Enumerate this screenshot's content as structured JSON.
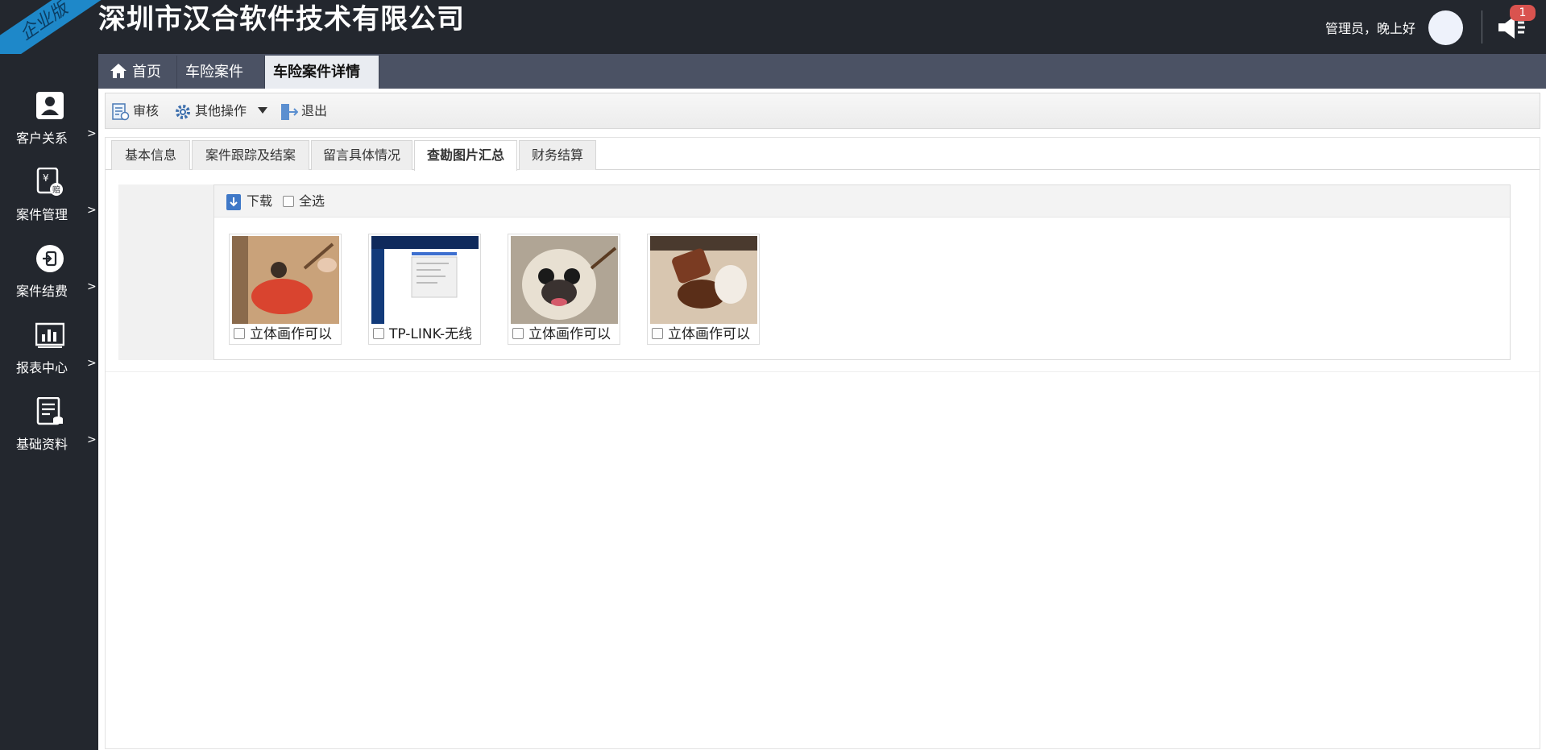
{
  "header": {
    "edition_ribbon": "企业版",
    "company_name": "深圳市汉合软件技术有限公司",
    "greeting": "管理员，晚上好",
    "notification_count": "1",
    "colors": {
      "bg": "#23272e",
      "badge": "#d9534f"
    }
  },
  "sidebar": {
    "items": [
      {
        "label": "客户关系",
        "icon": "contact-card-icon",
        "arrow": ">"
      },
      {
        "label": "案件管理",
        "icon": "claim-document-icon",
        "arrow": ">"
      },
      {
        "label": "案件结费",
        "icon": "sign-in-circle-icon",
        "arrow": ">"
      },
      {
        "label": "报表中心",
        "icon": "report-chart-icon",
        "arrow": ">"
      },
      {
        "label": "基础资料",
        "icon": "data-list-icon",
        "arrow": ">"
      }
    ]
  },
  "page_tabs": [
    {
      "label": "首页",
      "icon": "home-icon",
      "closable": false
    },
    {
      "label": "车险案件",
      "closable": true,
      "close": "×"
    },
    {
      "label": "车险案件详情",
      "closable": true,
      "close": "×",
      "active": true
    }
  ],
  "toolbar": {
    "audit_label": "审核",
    "other_ops_label": "其他操作",
    "exit_label": "退出"
  },
  "detail_tabs": [
    {
      "label": "基本信息"
    },
    {
      "label": "案件跟踪及结案"
    },
    {
      "label": "留言具体情况"
    },
    {
      "label": "查勘图片汇总",
      "active": true
    },
    {
      "label": "财务结算"
    }
  ],
  "photos_panel": {
    "download_label": "下载",
    "select_all_label": "全选",
    "photos": [
      {
        "caption": "立体画作可以"
      },
      {
        "caption": "TP-LINK-无线"
      },
      {
        "caption": "立体画作可以"
      },
      {
        "caption": "立体画作可以"
      }
    ]
  }
}
